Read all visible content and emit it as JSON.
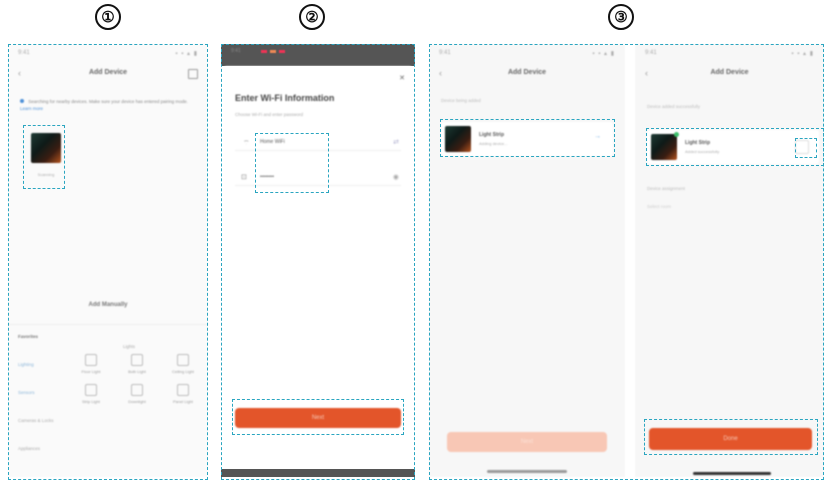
{
  "steps": [
    "①",
    "②",
    "③"
  ],
  "phone1": {
    "time": "9:41",
    "status_icons": "▪ ▪ ▴ ▮",
    "title": "Add Device",
    "back": "‹",
    "hint": "Searching for nearby devices. Make sure your device has entered pairing mode.",
    "hint_link": "Learn more",
    "device_caption": "Scanning",
    "add_manually": "Add Manually",
    "categories": [
      "Favorites",
      "Lighting",
      "Sensors",
      "Cameras & Locks",
      "Appliances"
    ],
    "category_right": "Lights",
    "grid_items": [
      "Floor Light",
      "Bulb Light",
      "Ceiling Light",
      "Strip Light",
      "Downlight",
      "Panel Light"
    ]
  },
  "phone2": {
    "title": "Enter Wi-Fi Information",
    "subtitle": "Choose Wi-Fi and enter password",
    "wifi_value": "Home WiFi",
    "password_value": "••••••••",
    "next_label": "Next",
    "close": "✕",
    "top_time": "9:41"
  },
  "phone3": {
    "time": "9:41",
    "status_icons": "▪ ▪ ▴ ▮",
    "title": "Add Device",
    "back": "‹",
    "section_label": "Device being added",
    "device_name": "Light Strip",
    "device_sub": "Adding device...",
    "arrow": "→",
    "button": "Next"
  },
  "phone4": {
    "time": "9:41",
    "status_icons": "▪ ▪ ▴ ▮",
    "title": "Add Device",
    "back": "‹",
    "section_label": "Device added successfully",
    "device_name": "Light Strip",
    "device_sub": "Added successfully",
    "section2": "Device assignment",
    "room": "Select room",
    "button": "Done"
  }
}
